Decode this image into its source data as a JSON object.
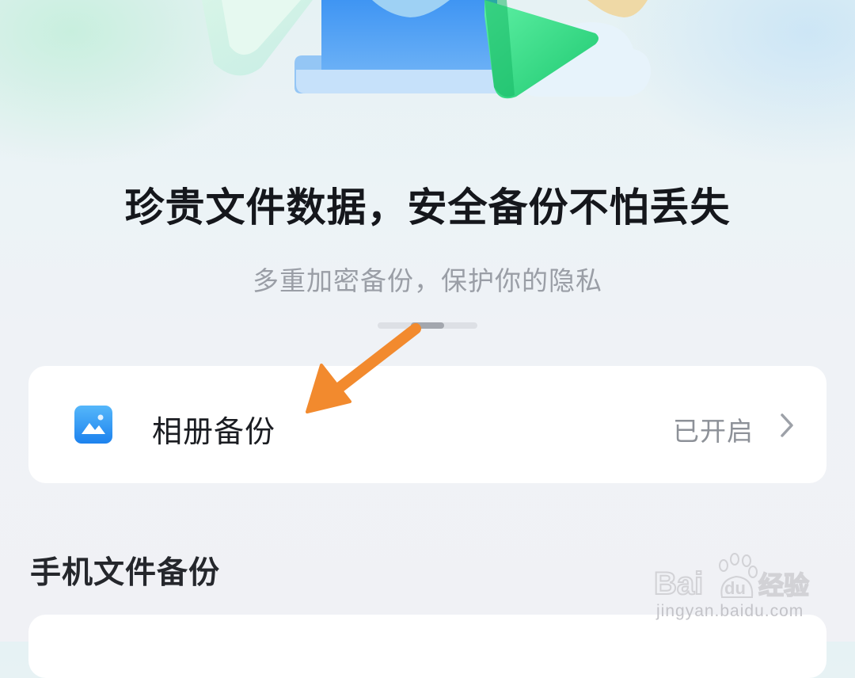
{
  "hero": {
    "headline": "珍贵文件数据，安全备份不怕丢失",
    "subline": "多重加密备份，保护你的隐私"
  },
  "pager": {
    "count": 3,
    "active_index": 1
  },
  "album_backup": {
    "label": "相册备份",
    "status": "已开启",
    "icon": "album-icon"
  },
  "phone_files": {
    "section_title": "手机文件备份"
  },
  "annotation": {
    "arrow_color": "#f28a2e"
  },
  "watermark": {
    "logo_text": "Bai du 经验",
    "url": "jingyan.baidu.com"
  }
}
